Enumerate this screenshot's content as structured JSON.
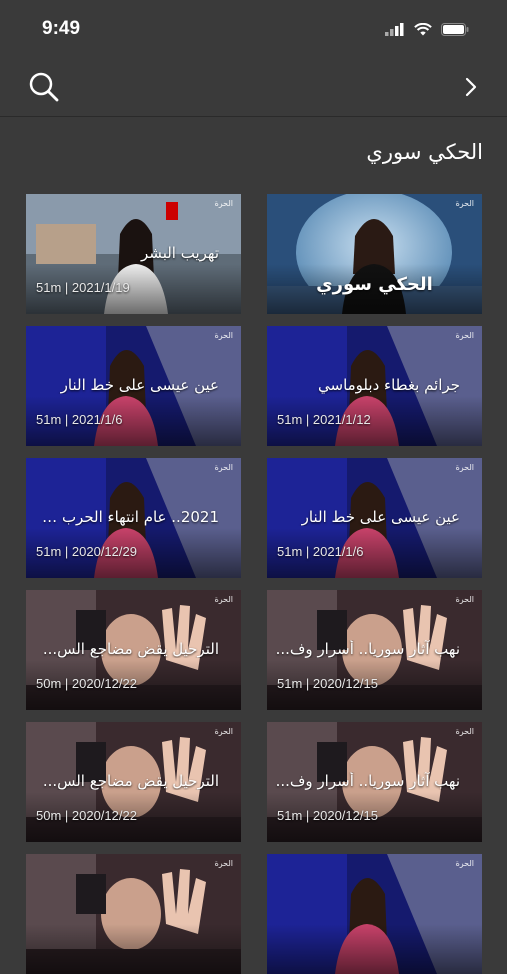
{
  "status": {
    "time": "9:49"
  },
  "page": {
    "title": "الحكي سوري"
  },
  "cards": [
    {
      "title": "الحكي سوري",
      "meta": "",
      "logo": "الحرة",
      "theme": "cover"
    },
    {
      "title": "تهريب البشر",
      "meta": "51m | 2021/1/19",
      "logo": "الحرة",
      "theme": "harbor"
    },
    {
      "title": "جرائم بغطاء دبلوماسي",
      "meta": "51m | 2021/1/12",
      "logo": "الحرة",
      "theme": "studio"
    },
    {
      "title": "عين عيسى على خط النار",
      "meta": "51m | 2021/1/6",
      "logo": "الحرة",
      "theme": "studio"
    },
    {
      "title": "عين عيسى على خط النار",
      "meta": "51m | 2021/1/6",
      "logo": "الحرة",
      "theme": "studio"
    },
    {
      "title": "2021.. عام انتهاء الحرب ف...",
      "meta": "51m | 2020/12/29",
      "logo": "الحرة",
      "theme": "studio"
    },
    {
      "title": "نهب آثار سوريا.. أسرار وف...",
      "meta": "51m | 2020/12/15",
      "logo": "الحرة",
      "theme": "child"
    },
    {
      "title": "الترحيل يقض مضاجع الس...",
      "meta": "50m | 2020/12/22",
      "logo": "الحرة",
      "theme": "child"
    },
    {
      "title": "نهب آثار سوريا.. أسرار وف...",
      "meta": "51m | 2020/12/15",
      "logo": "الحرة",
      "theme": "child"
    },
    {
      "title": "الترحيل يقض مضاجع الس...",
      "meta": "50m | 2020/12/22",
      "logo": "الحرة",
      "theme": "child"
    },
    {
      "title": "",
      "meta": "",
      "logo": "الحرة",
      "theme": "studio"
    },
    {
      "title": "",
      "meta": "",
      "logo": "الحرة",
      "theme": "child"
    }
  ]
}
